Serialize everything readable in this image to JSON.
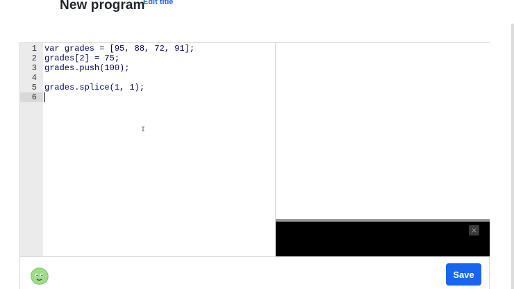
{
  "header": {
    "title": "New program",
    "edit_title_label": "Edit title"
  },
  "editor": {
    "lines": [
      {
        "number": "1",
        "text": "var grades = [95, 88, 72, 91];"
      },
      {
        "number": "2",
        "text": "grades[2] = 75;"
      },
      {
        "number": "3",
        "text": "grades.push(100);"
      },
      {
        "number": "4",
        "text": ""
      },
      {
        "number": "5",
        "text": "grades.splice(1, 1);"
      },
      {
        "number": "6",
        "text": ""
      }
    ],
    "active_line": 6,
    "cursor_glyph": "I"
  },
  "console": {
    "close_label": "×"
  },
  "footer": {
    "save_label": "Save"
  },
  "colors": {
    "accent": "#1865f2",
    "gutter": "#ebebeb",
    "console_bg": "#000000",
    "avatar": "#9fdc8a"
  },
  "icons": {
    "avatar": "green-blob-avatar-icon",
    "console_close": "close-icon"
  }
}
